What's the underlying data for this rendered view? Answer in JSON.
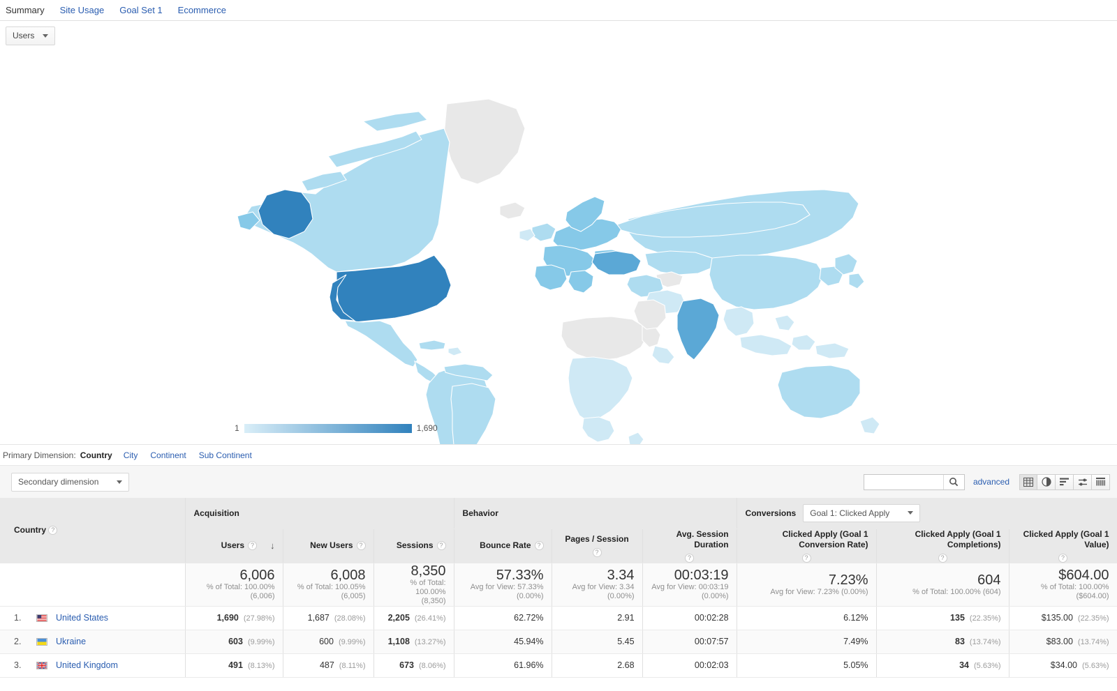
{
  "tabs": [
    {
      "label": "Summary",
      "active": true
    },
    {
      "label": "Site Usage",
      "active": false
    },
    {
      "label": "Goal Set 1",
      "active": false
    },
    {
      "label": "Ecommerce",
      "active": false
    }
  ],
  "metric_selector": {
    "label": "Users"
  },
  "map": {
    "legend_min": "1",
    "legend_max": "1,690",
    "color_low": "#d9eef8",
    "color_high": "#3182bd",
    "no_data_color": "#e8e8e8"
  },
  "primary_dimension": {
    "label": "Primary Dimension:",
    "current": "Country",
    "options": [
      "City",
      "Continent",
      "Sub Continent"
    ]
  },
  "controls": {
    "secondary_dimension": "Secondary dimension",
    "search_value": "",
    "search_placeholder": "",
    "advanced": "advanced",
    "view_buttons": [
      {
        "name": "table-view-icon",
        "active": true
      },
      {
        "name": "pie-chart-view-icon",
        "active": false
      },
      {
        "name": "performance-view-icon",
        "active": false
      },
      {
        "name": "comparison-view-icon",
        "active": false
      },
      {
        "name": "pivot-view-icon",
        "active": false
      }
    ]
  },
  "table": {
    "groups": [
      {
        "label": "Acquisition"
      },
      {
        "label": "Behavior"
      },
      {
        "label": "Conversions",
        "goal_selector": "Goal 1: Clicked Apply"
      }
    ],
    "country_header": "Country",
    "columns": [
      "Users",
      "New Users",
      "Sessions",
      "Bounce Rate",
      "Pages / Session",
      "Avg. Session Duration",
      "Clicked Apply (Goal 1 Conversion Rate)",
      "Clicked Apply (Goal 1 Completions)",
      "Clicked Apply (Goal 1 Value)"
    ],
    "sorted_column": "Users",
    "sort_direction": "desc",
    "totals": [
      {
        "value": "6,006",
        "note1": "% of Total: 100.00%",
        "note2": "(6,006)"
      },
      {
        "value": "6,008",
        "note1": "% of Total: 100.05%",
        "note2": "(6,005)"
      },
      {
        "value": "8,350",
        "note1": "% of Total: 100.00%",
        "note2": "(8,350)"
      },
      {
        "value": "57.33%",
        "note1": "Avg for View: 57.33%",
        "note2": "(0.00%)"
      },
      {
        "value": "3.34",
        "note1": "Avg for View: 3.34",
        "note2": "(0.00%)"
      },
      {
        "value": "00:03:19",
        "note1": "Avg for View: 00:03:19",
        "note2": "(0.00%)"
      },
      {
        "value": "7.23%",
        "note1": "Avg for View: 7.23% (0.00%)",
        "note2": ""
      },
      {
        "value": "604",
        "note1": "% of Total: 100.00% (604)",
        "note2": ""
      },
      {
        "value": "$604.00",
        "note1": "% of Total: 100.00%",
        "note2": "($604.00)"
      }
    ],
    "rows": [
      {
        "rank": "1.",
        "country": "United States",
        "flag": "us",
        "users": "1,690",
        "users_pct": "(27.98%)",
        "new_users": "1,687",
        "new_users_pct": "(28.08%)",
        "sessions": "2,205",
        "sessions_pct": "(26.41%)",
        "bounce_rate": "62.72%",
        "pages_session": "2.91",
        "avg_duration": "00:02:28",
        "goal_rate": "6.12%",
        "goal_completions": "135",
        "goal_completions_pct": "(22.35%)",
        "goal_value": "$135.00",
        "goal_value_pct": "(22.35%)"
      },
      {
        "rank": "2.",
        "country": "Ukraine",
        "flag": "ua",
        "users": "603",
        "users_pct": "(9.99%)",
        "new_users": "600",
        "new_users_pct": "(9.99%)",
        "sessions": "1,108",
        "sessions_pct": "(13.27%)",
        "bounce_rate": "45.94%",
        "pages_session": "5.45",
        "avg_duration": "00:07:57",
        "goal_rate": "7.49%",
        "goal_completions": "83",
        "goal_completions_pct": "(13.74%)",
        "goal_value": "$83.00",
        "goal_value_pct": "(13.74%)"
      },
      {
        "rank": "3.",
        "country": "United Kingdom",
        "flag": "gb",
        "users": "491",
        "users_pct": "(8.13%)",
        "new_users": "487",
        "new_users_pct": "(8.11%)",
        "sessions": "673",
        "sessions_pct": "(8.06%)",
        "bounce_rate": "61.96%",
        "pages_session": "2.68",
        "avg_duration": "00:02:03",
        "goal_rate": "5.05%",
        "goal_completions": "34",
        "goal_completions_pct": "(5.63%)",
        "goal_value": "$34.00",
        "goal_value_pct": "(5.63%)"
      }
    ]
  }
}
